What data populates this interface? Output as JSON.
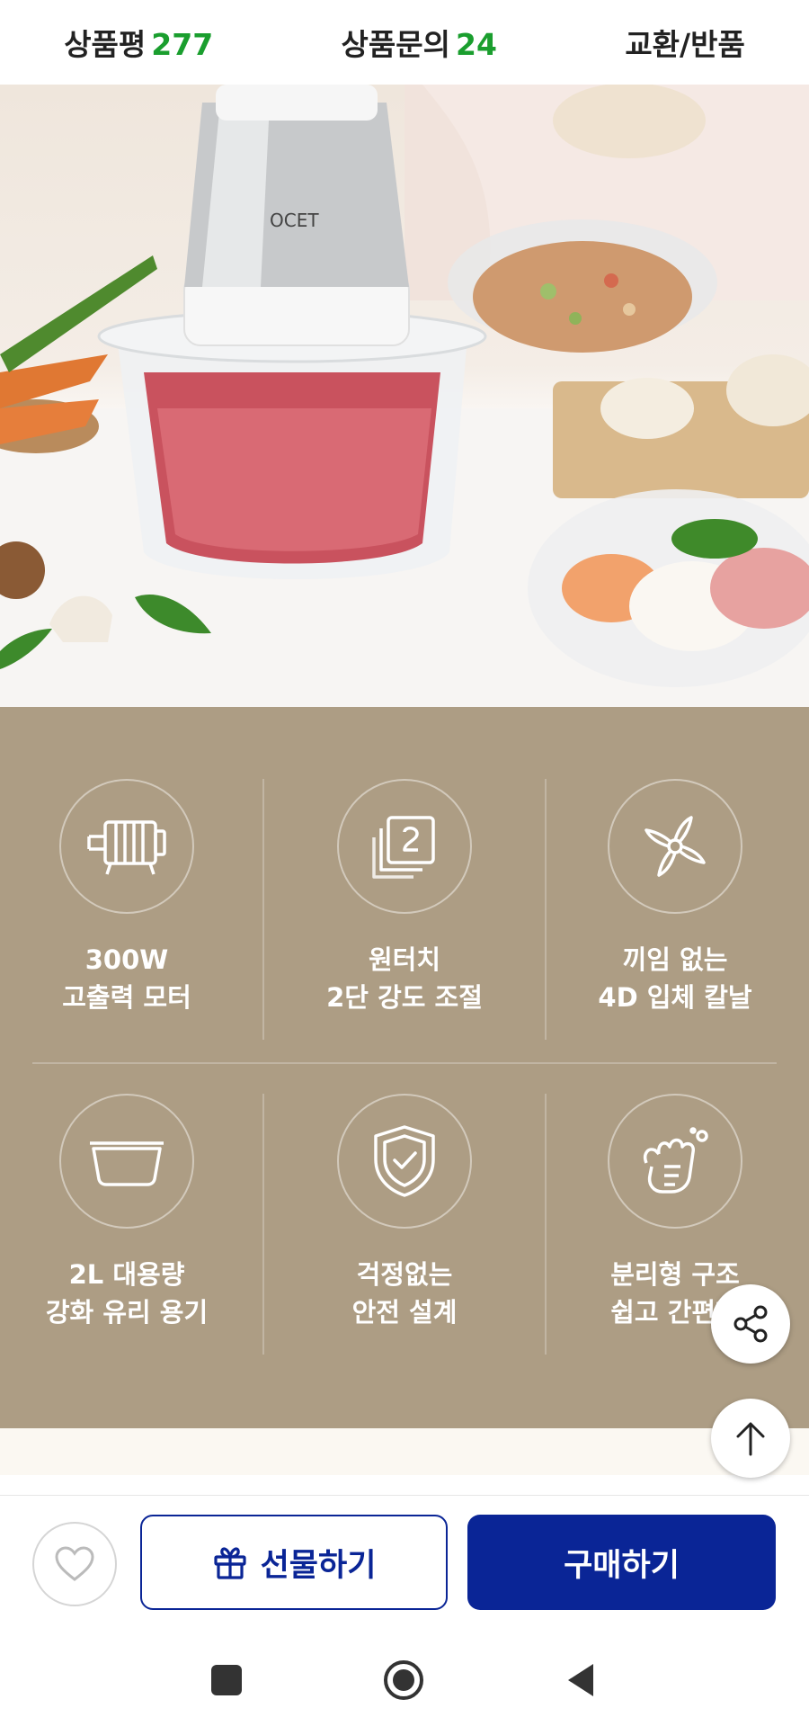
{
  "tabs": [
    {
      "label": "상품평",
      "count": "277"
    },
    {
      "label": "상품문의",
      "count": "24"
    },
    {
      "label": "교환/반품",
      "count": ""
    }
  ],
  "photo": {
    "brand_mark": "OCET"
  },
  "features": [
    {
      "icon": "motor-icon",
      "line1": "300W",
      "line2": "고출력 모터"
    },
    {
      "icon": "two-step-icon",
      "line1": "원터치",
      "line2": "2단 강도 조절"
    },
    {
      "icon": "blade-icon",
      "line1": "끼임 없는",
      "line2": "4D 입체 칼날"
    },
    {
      "icon": "glass-bowl-icon",
      "line1": "2L 대용량",
      "line2": "강화 유리 용기"
    },
    {
      "icon": "shield-check-icon",
      "line1": "걱정없는",
      "line2": "안전 설계"
    },
    {
      "icon": "wash-hands-icon",
      "line1": "분리형 구조",
      "line2": "쉽고 간편한"
    }
  ],
  "actions": {
    "gift_label": "선물하기",
    "buy_label": "구매하기"
  },
  "colors": {
    "accent_green": "#1a9e2e",
    "brand_blue": "#0a2596",
    "panel_bg": "#ad9d84"
  }
}
